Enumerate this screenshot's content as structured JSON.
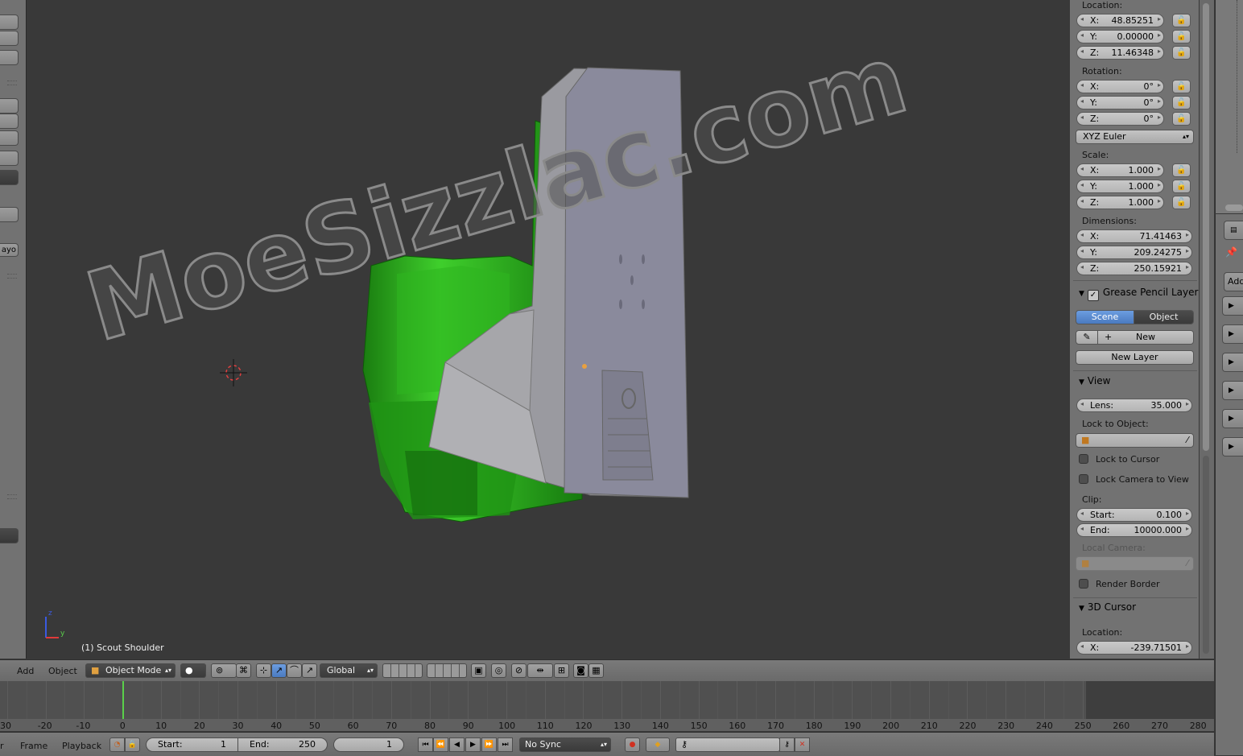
{
  "left_shelf": {
    "cut_label": "ayo"
  },
  "viewport": {
    "object_label": "(1) Scout Shoulder",
    "watermark": "MoeSizzlac.com",
    "axis_z": "z",
    "axis_y": "y"
  },
  "props": {
    "location": {
      "label": "Location:",
      "x_key": "X:",
      "x": "48.85251",
      "y_key": "Y:",
      "y": "0.00000",
      "z_key": "Z:",
      "z": "11.46348"
    },
    "rotation": {
      "label": "Rotation:",
      "x_key": "X:",
      "x": "0°",
      "y_key": "Y:",
      "y": "0°",
      "z_key": "Z:",
      "z": "0°"
    },
    "rotation_mode": "XYZ Euler",
    "scale": {
      "label": "Scale:",
      "x_key": "X:",
      "x": "1.000",
      "y_key": "Y:",
      "y": "1.000",
      "z_key": "Z:",
      "z": "1.000"
    },
    "dimensions": {
      "label": "Dimensions:",
      "x_key": "X:",
      "x": "71.41463",
      "y_key": "Y:",
      "y": "209.24275",
      "z_key": "Z:",
      "z": "250.15921"
    },
    "grease_pencil": {
      "title": "Grease Pencil Layers",
      "tab_scene": "Scene",
      "tab_object": "Object",
      "new_label": "New",
      "new_layer_label": "New Layer"
    },
    "view": {
      "title": "View",
      "lens_key": "Lens:",
      "lens_value": "35.000",
      "lock_to_object_label": "Lock to Object:",
      "lock_to_cursor_label": "Lock to Cursor",
      "lock_camera_label": "Lock Camera to View",
      "clip_label": "Clip:",
      "clip_start_key": "Start:",
      "clip_start_value": "0.100",
      "clip_end_key": "End:",
      "clip_end_value": "10000.000",
      "local_camera_label": "Local Camera:",
      "render_border_label": "Render Border"
    },
    "cursor": {
      "title": "3D Cursor",
      "location_label": "Location:",
      "x_key": "X:",
      "x": "-239.71501"
    }
  },
  "right_strip": {
    "add_label": "Add"
  },
  "header3d": {
    "menu_add": "Add",
    "menu_object": "Object",
    "mode": "Object Mode",
    "orientation": "Global"
  },
  "timeline": {
    "ticks": [
      "30",
      "-20",
      "-10",
      "0",
      "10",
      "20",
      "30",
      "40",
      "50",
      "60",
      "70",
      "80",
      "90",
      "100",
      "110",
      "120",
      "130",
      "140",
      "150",
      "160",
      "170",
      "180",
      "190",
      "200",
      "210",
      "220",
      "230",
      "240",
      "250",
      "260",
      "270",
      "280"
    ],
    "current_frame": 1
  },
  "footer": {
    "menu_view_cut": "r",
    "menu_frame": "Frame",
    "menu_playback": "Playback",
    "start_key": "Start:",
    "start_value": "1",
    "end_key": "End:",
    "end_value": "250",
    "current_value": "1",
    "sync": "No Sync"
  },
  "colors": {
    "viewport_bg": "#393939",
    "panel_bg": "#727272",
    "selected_tab": "#5a8ad0",
    "playhead": "#5ad04a",
    "green_mesh": "#1f8f12",
    "grey_mesh": "#8e8e9c"
  }
}
